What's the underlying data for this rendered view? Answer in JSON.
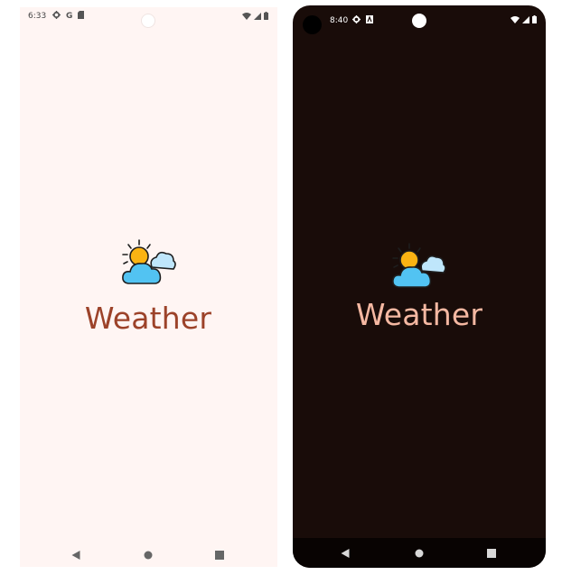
{
  "light_screen": {
    "status_bar": {
      "time": "6:33",
      "google_glyph": "G",
      "left_icons": [
        "gear-icon",
        "google-icon",
        "sd-card-icon"
      ],
      "right_icons": [
        "wifi-icon",
        "signal-icon",
        "battery-icon"
      ]
    },
    "app": {
      "icon": "weather-sun-cloud-icon",
      "name": "Weather"
    },
    "nav_bar": [
      "back-icon",
      "home-icon",
      "recents-icon"
    ],
    "colors": {
      "background": "#fff5f3",
      "title": "#9c4229"
    }
  },
  "dark_screen": {
    "status_bar": {
      "time": "8:40",
      "left_icons": [
        "gear-icon",
        "a-badge-icon"
      ],
      "right_icons": [
        "wifi-icon",
        "signal-icon",
        "battery-icon"
      ]
    },
    "app": {
      "icon": "weather-sun-cloud-icon",
      "name": "Weather"
    },
    "nav_bar": [
      "back-icon",
      "home-icon",
      "recents-icon"
    ],
    "colors": {
      "background": "#190c09",
      "title": "#f5b8a2"
    }
  }
}
